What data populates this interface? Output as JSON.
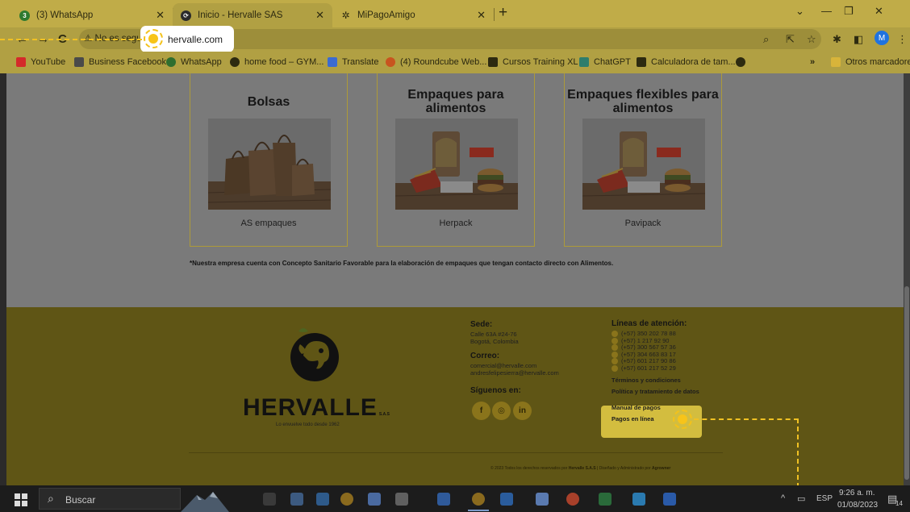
{
  "browser": {
    "tabs": [
      {
        "title": "(3) WhatsApp",
        "icon": "whatsapp-icon",
        "active": false
      },
      {
        "title": "Inicio - Hervalle SAS",
        "icon": "hervalle-favicon",
        "active": true
      },
      {
        "title": "MiPagoAmigo",
        "icon": "mipagoamigo-favicon",
        "active": false
      }
    ],
    "security_label": "No es seguro",
    "url": "hervalle.com",
    "profile_initial": "M",
    "bookmarks": [
      {
        "label": "YouTube",
        "icon": "youtube-icon",
        "color": "#d42a2a"
      },
      {
        "label": "Business Facebook",
        "icon": "facebook-icon",
        "color": "#4a4a4a"
      },
      {
        "label": "WhatsApp",
        "icon": "whatsapp-icon",
        "color": "#2f6e2f"
      },
      {
        "label": "home food – GYM...",
        "icon": "globe-icon",
        "color": "#2d2a10"
      },
      {
        "label": "Translate",
        "icon": "translate-icon",
        "color": "#3b6bd1"
      },
      {
        "label": "(4) Roundcube Web...",
        "icon": "roundcube-icon",
        "color": "#c8541f"
      },
      {
        "label": "Cursos Training XL",
        "icon": "training-icon",
        "color": "#2d2a10"
      },
      {
        "label": "ChatGPT",
        "icon": "chatgpt-icon",
        "color": "#2e7d6c"
      },
      {
        "label": "Calculadora de tam...",
        "icon": "calculator-icon",
        "color": "#2d2a10"
      }
    ],
    "more_bookmarks": "»",
    "other_bookmarks": "Otros marcadores"
  },
  "page": {
    "products": [
      {
        "title": "Bolsas",
        "label": "AS empaques"
      },
      {
        "title": "Empaques para alimentos",
        "label": "Herpack"
      },
      {
        "title": "Empaques flexibles para alimentos",
        "label": "Pavipack"
      }
    ],
    "notice": "*Nuestra empresa cuenta con Concepto Sanitario Favorable para la elaboración de empaques que tengan contacto directo con Alimentos."
  },
  "footer": {
    "brand": "HERVALLE",
    "brand_suffix": "S.A.S",
    "tagline": "Lo envuelve todo desde 1962",
    "sede_heading": "Sede:",
    "sede_lines": [
      "Calle 63A #24-76",
      "Bogotá, Colombia"
    ],
    "correo_heading": "Correo:",
    "correo_lines": [
      "comercial@hervalle.com",
      "andresfelipesierra@hervalle.com"
    ],
    "siguenos_heading": "Síguenos en:",
    "social": [
      {
        "label": "f",
        "icon": "facebook-icon"
      },
      {
        "label": "◎",
        "icon": "instagram-icon"
      },
      {
        "label": "in",
        "icon": "linkedin-icon"
      }
    ],
    "lineas_heading": "Líneas de atención:",
    "phones": [
      "(+57) 350 202 78 88",
      "(+57) 1 217 92 90",
      "(+57) 300 567 57 36",
      "(+57) 304 663 83 17",
      "(+57) 601 217 90 86",
      "(+57) 601 217 52 29"
    ],
    "links": [
      "Términos y condiciones",
      "Política y tratamiento de datos",
      "Manual de pagos",
      "Pagos en línea"
    ],
    "copyright_prefix": "© 2023 Todos los derechos reservados por ",
    "copyright_owner": "Hervalle S.A.S",
    "copyright_mid": " | Diseñado y Administrado por ",
    "copyright_agency": "Agrowner"
  },
  "taskbar": {
    "search_label": "Buscar",
    "language": "ESP",
    "time": "9:26 a. m.",
    "date": "01/08/2023",
    "notifications": "14"
  },
  "colors": {
    "accent": "#f3c21a",
    "tab_bar": "#c0ac48",
    "footer_gold": "#d3bd3f"
  }
}
